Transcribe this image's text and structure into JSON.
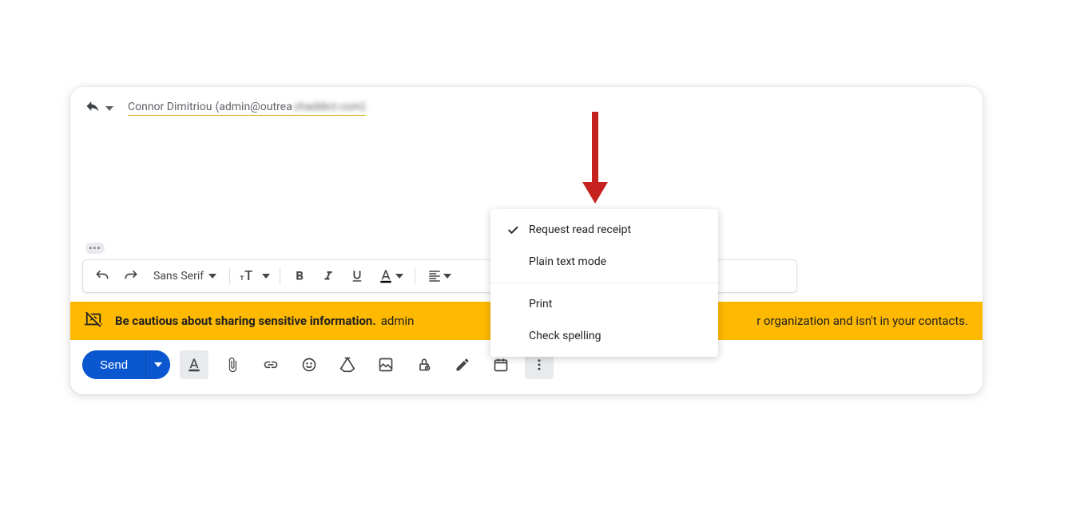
{
  "recipient": {
    "name": "Connor Dimitriou",
    "emailPrefix": "(admin@outrea",
    "emailBlurred": "chaddict.com)"
  },
  "formatting": {
    "font": "Sans Serif"
  },
  "warning": {
    "bold": "Be cautious about sharing sensitive information.",
    "normal_left": "admin",
    "normal_right": "r organization and isn't in your contacts."
  },
  "send": {
    "label": "Send"
  },
  "menu": {
    "items": [
      {
        "label": "Request read receipt",
        "checked": true
      },
      {
        "label": "Plain text mode",
        "checked": false
      }
    ],
    "items2": [
      {
        "label": "Print"
      },
      {
        "label": "Check spelling"
      }
    ]
  }
}
